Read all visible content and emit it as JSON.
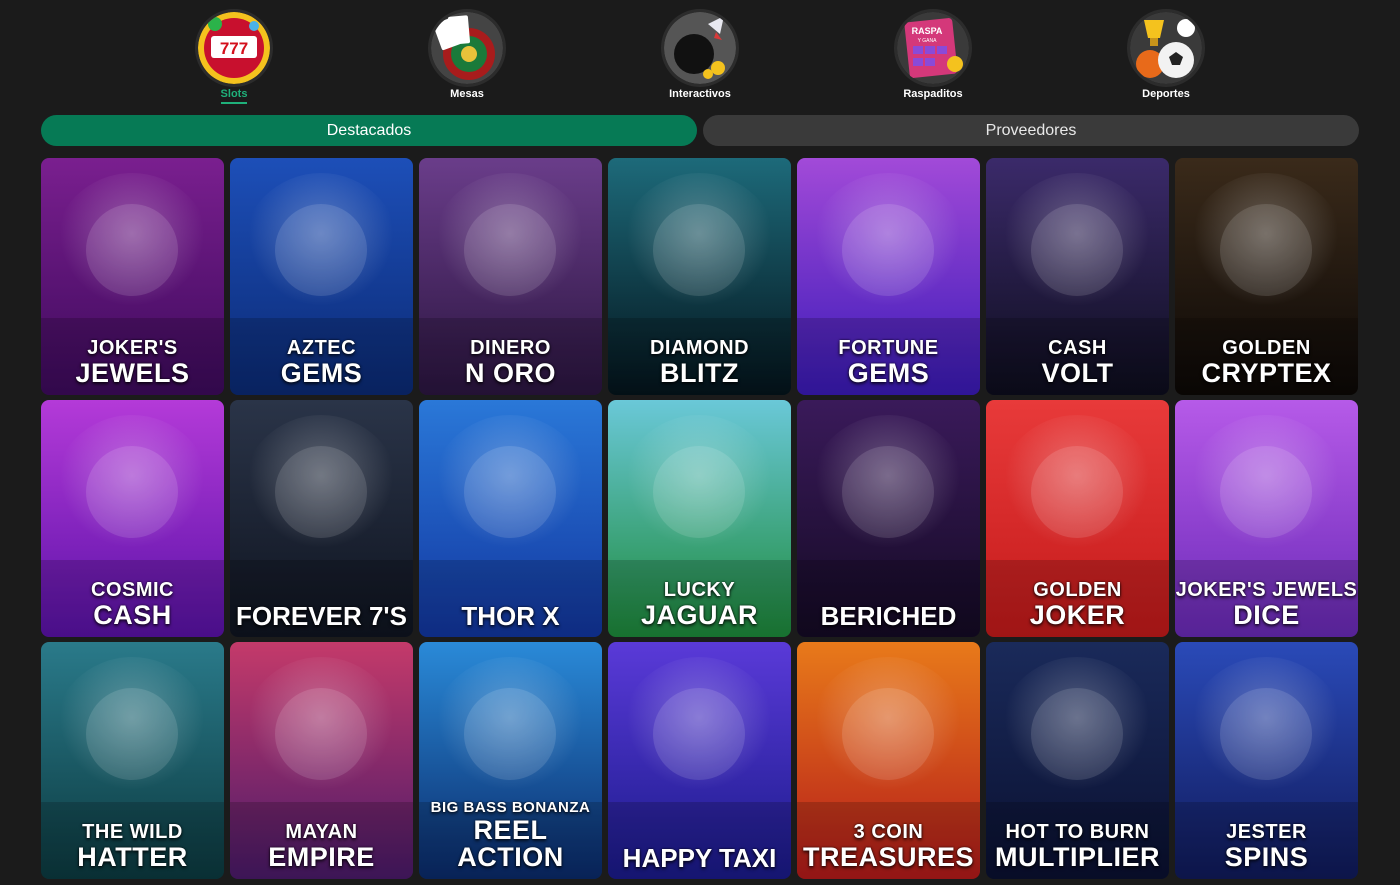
{
  "categories": [
    {
      "label": "Slots",
      "icon": "slot-machine-icon",
      "active": true
    },
    {
      "label": "Mesas",
      "icon": "roulette-cards-icon",
      "active": false
    },
    {
      "label": "Interactivos",
      "icon": "bomb-rocket-icon",
      "active": false
    },
    {
      "label": "Raspaditos",
      "icon": "scratch-card-icon",
      "active": false
    },
    {
      "label": "Deportes",
      "icon": "sports-balls-icon",
      "active": false
    }
  ],
  "scratch_icon_text": {
    "line1": "RASPA",
    "line2": "Y GANA"
  },
  "tabs": [
    {
      "label": "Destacados",
      "active": true
    },
    {
      "label": "Proveedores",
      "active": false
    }
  ],
  "games": [
    {
      "line1": "JOKER'S",
      "line2": "JEWELS",
      "bg1": "#7a1f8f",
      "bg2": "#3d0a5c",
      "icon": "jester-icon"
    },
    {
      "line1": "AZTEC",
      "line2": "GEMS",
      "bg1": "#1d4fb8",
      "bg2": "#0b2a75",
      "icon": "aztec-coin-icon"
    },
    {
      "line1": "DINERO",
      "line2": "N ORO",
      "bg1": "#6a3d8a",
      "bg2": "#2b1540",
      "icon": "aztec-woman-icon"
    },
    {
      "line1": "DIAMOND",
      "line2": "BLITZ",
      "bg1": "#1d6a7a",
      "bg2": "#04141c",
      "icon": "diamond-icon"
    },
    {
      "line1": "FORTUNE",
      "line2": "GEMS",
      "bg1": "#a24ad8",
      "bg2": "#3a1ab8",
      "icon": "golden-mask-icon"
    },
    {
      "line1": "CASH",
      "line2": "VOLT",
      "bg1": "#3b2a6a",
      "bg2": "#0d0d1d",
      "icon": "cash-volt-logo-icon"
    },
    {
      "line1": "GOLDEN",
      "line2": "CRYPTEX",
      "bg1": "#3a2a1a",
      "bg2": "#0c0806",
      "icon": "cryptex-icon"
    },
    {
      "line1": "COSMIC",
      "line2": "CASH",
      "bg1": "#b43ad8",
      "bg2": "#5a12a8",
      "icon": "alien-icon"
    },
    {
      "single": "FOREVER 7'S",
      "bg1": "#2a3448",
      "bg2": "#0f1420",
      "icon": "golden-seven-icon"
    },
    {
      "single": "THOR X",
      "bg1": "#2a78d8",
      "bg2": "#1236a0",
      "icon": "viking-icon"
    },
    {
      "line1": "LUCKY",
      "line2": "JAGUAR",
      "bg1": "#6ac8d8",
      "bg2": "#1d8a3a",
      "icon": "jaguar-icon"
    },
    {
      "single": "BERICHED",
      "bg1": "#3a1a5a",
      "bg2": "#140a24",
      "icon": "treasure-chest-icon"
    },
    {
      "line1": "GOLDEN",
      "line2": "JOKER",
      "bg1": "#e83a3a",
      "bg2": "#c41a1a",
      "icon": "jester-woman-icon"
    },
    {
      "line1": "JOKER'S JEWELS",
      "line2": "DICE",
      "bg1": "#b65ae8",
      "bg2": "#6a2ab8",
      "icon": "jester-lady-icon"
    },
    {
      "line1": "THE WILD",
      "line2": "HATTER",
      "bg1": "#2a7a8a",
      "bg2": "#0c3a40",
      "icon": "top-hat-icon"
    },
    {
      "line1": "MAYAN",
      "line2": "EMPIRE",
      "bg1": "#c43a6a",
      "bg2": "#4a1a6a",
      "icon": "mayan-woman-icon"
    },
    {
      "line1": "BIG BASS BONANZA",
      "line2": "REEL ACTION",
      "bg1": "#2a8ad8",
      "bg2": "#0a2a6a",
      "icon": "fisherman-icon",
      "small1": true
    },
    {
      "single": "HAPPY TAXI",
      "bg1": "#5a3ad8",
      "bg2": "#1a1a8a",
      "icon": "taxi-car-icon"
    },
    {
      "line1": "3 COIN",
      "line2": "TREASURES",
      "bg1": "#e87a1a",
      "bg2": "#b41a1a",
      "icon": "dragon-coin-icon"
    },
    {
      "line1": "HOT TO BURN",
      "line2": "MULTIPLIER",
      "bg1": "#1a2a5a",
      "bg2": "#0a1030",
      "icon": "fruits-seven-icon"
    },
    {
      "line1": "JESTER",
      "line2": "SPINS",
      "bg1": "#2a4ab8",
      "bg2": "#101a5a",
      "icon": "jester-hat-seven-icon"
    }
  ]
}
